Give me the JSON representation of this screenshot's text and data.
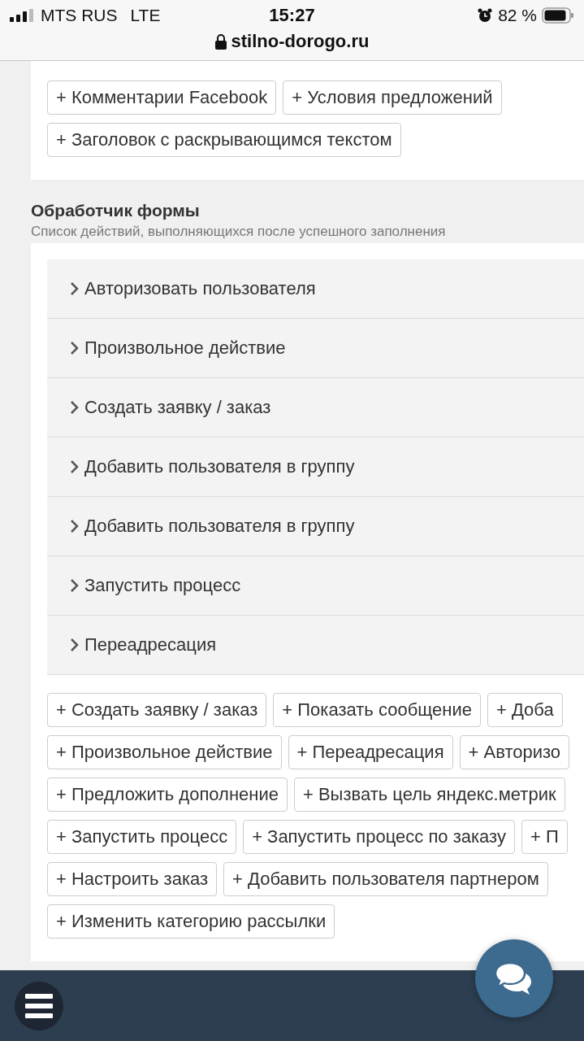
{
  "status_bar": {
    "carrier": "MTS RUS",
    "network": "LTE",
    "time": "15:27",
    "battery": "82 %"
  },
  "address_bar": {
    "url": "stilno-dorogo.ru"
  },
  "blocks_panel": {
    "rows": [
      [
        "+ Комментарии Facebook",
        "+ Условия предложений"
      ],
      [
        "+ Заголовок с раскрывающимся текстом"
      ]
    ]
  },
  "form_handler": {
    "title": "Обработчик формы",
    "subtitle": "Список действий, выполняющихся после успешного заполнения",
    "actions": [
      {
        "label": "Авторизовать пользователя",
        "expanded": false
      },
      {
        "label": "Произвольное действие",
        "expanded": false
      },
      {
        "label": "Создать заявку / заказ",
        "expanded": false
      },
      {
        "label": "Добавить пользователя в группу",
        "expanded": false
      },
      {
        "label": "Добавить пользователя в группу",
        "expanded": false
      },
      {
        "label": "Запустить процесс",
        "expanded": false
      },
      {
        "label": "Переадресация",
        "expanded": false
      }
    ],
    "add_rows": [
      [
        "+ Создать заявку / заказ",
        "+ Показать сообщение",
        "+ Доба"
      ],
      [
        "+ Произвольное действие",
        "+ Переадресация",
        "+ Авторизо"
      ],
      [
        "+ Предложить дополнение",
        "+ Вызвать цель яндекс.метрик"
      ],
      [
        "+ Запустить процесс",
        "+ Запустить процесс по заказу",
        "+ П"
      ],
      [
        "+ Настроить заказ",
        "+ Добавить пользователя партнером"
      ],
      [
        "+ Изменить категорию рассылки"
      ]
    ]
  }
}
